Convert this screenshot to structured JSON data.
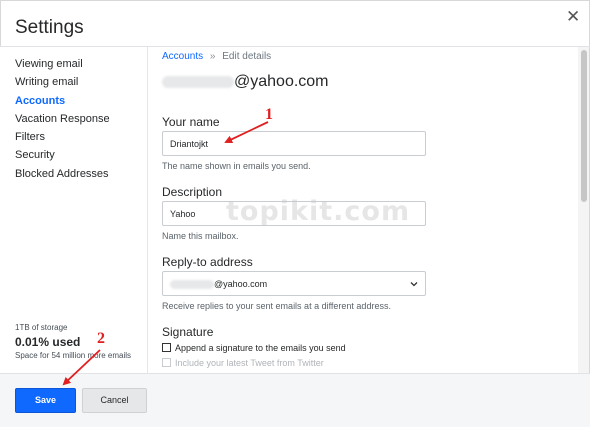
{
  "dialog": {
    "title": "Settings"
  },
  "sidebar": {
    "items": [
      {
        "label": "Viewing email",
        "active": false
      },
      {
        "label": "Writing email",
        "active": false
      },
      {
        "label": "Accounts",
        "active": true
      },
      {
        "label": "Vacation Response",
        "active": false
      },
      {
        "label": "Filters",
        "active": false
      },
      {
        "label": "Security",
        "active": false
      },
      {
        "label": "Blocked Addresses",
        "active": false
      }
    ],
    "storage": {
      "total": "1TB of storage",
      "used": "0.01% used",
      "note": "Space for 54 million more emails"
    }
  },
  "breadcrumb": {
    "link": "Accounts",
    "separator": "»",
    "current": "Edit details"
  },
  "account": {
    "email_domain": "@yahoo.com"
  },
  "form": {
    "your_name": {
      "label": "Your name",
      "value": "Driantojkt",
      "help": "The name shown in emails you send."
    },
    "description": {
      "label": "Description",
      "value": "Yahoo",
      "help": "Name this mailbox."
    },
    "reply_to": {
      "label": "Reply-to address",
      "value_domain": "@yahoo.com",
      "help": "Receive replies to your sent emails at a different address."
    },
    "signature": {
      "label": "Signature",
      "append_label": "Append a signature to the emails you send",
      "append_checked": false,
      "tweet_label": "Include your latest Tweet from Twitter",
      "tweet_checked": false
    }
  },
  "footer": {
    "save_label": "Save",
    "cancel_label": "Cancel"
  },
  "watermark": "topikit.com",
  "annotations": {
    "one": "1",
    "two": "2"
  },
  "icons": {
    "close": "close-icon",
    "dropdown": "chevron-down-icon",
    "breadcrumb_sep": "double-chevron-icon"
  },
  "colors": {
    "accent": "#0f69ff",
    "annotation": "#e02020"
  }
}
